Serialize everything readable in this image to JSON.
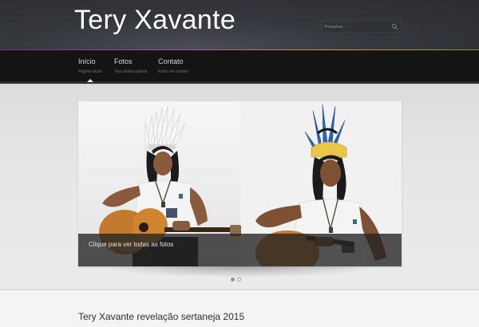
{
  "site": {
    "title": "Tery Xavante"
  },
  "search": {
    "placeholder": "Pesquisar..."
  },
  "nav": [
    {
      "label": "Início",
      "sub": "Página inicial"
    },
    {
      "label": "Fotos",
      "sub": "Veja minha galeria"
    },
    {
      "label": "Contato",
      "sub": "Entre em contato"
    }
  ],
  "slider": {
    "caption": "Clique para ver todas as fotos",
    "slide_count": 2,
    "active_slide": 1
  },
  "content": {
    "post_title": "Tery Xavante revelação sertaneja 2015"
  },
  "colors": {
    "header_bg": "#2b2d31",
    "nav_bg": "#141414",
    "accent_gradient": [
      "#7a2a8a",
      "#b04fa0",
      "#c8a03a"
    ]
  }
}
